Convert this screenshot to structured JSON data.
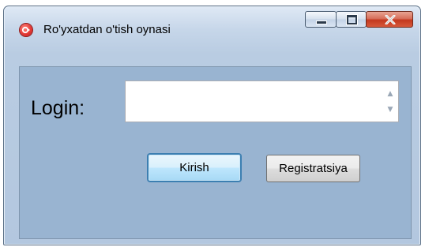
{
  "window": {
    "title": "Ro'yxatdan o'tish oynasi",
    "icons": {
      "app": "app-icon",
      "minimize": "minimize-icon",
      "maximize": "maximize-icon",
      "close": "close-icon"
    },
    "colors": {
      "client_bg": "#99b4d1",
      "close_button": "#c4381e"
    }
  },
  "form": {
    "login_label": "Login:",
    "login_value": "",
    "buttons": {
      "kirish": "Kirish",
      "registratsiya": "Registratsiya"
    }
  }
}
